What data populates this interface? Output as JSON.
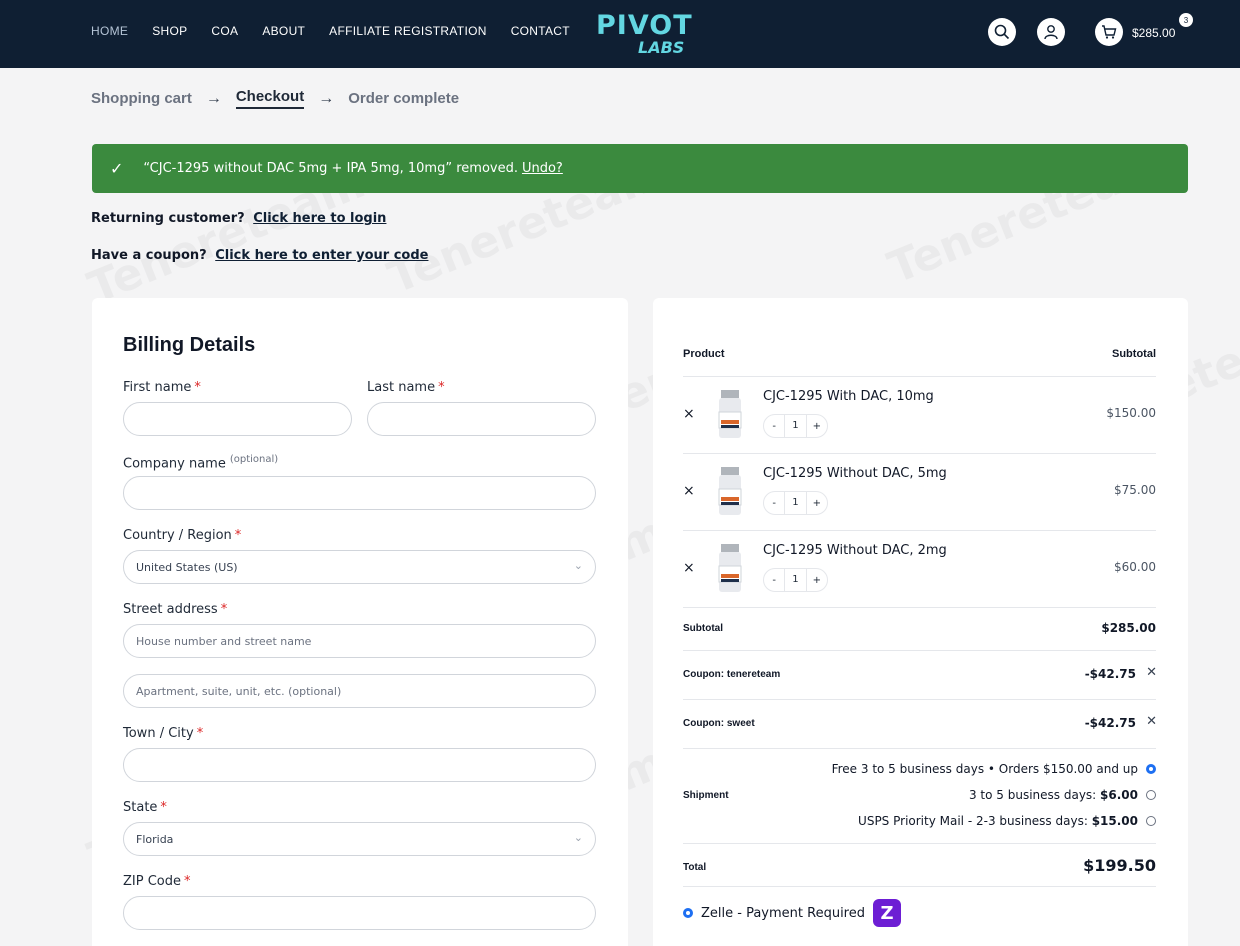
{
  "header": {
    "nav": [
      "HOME",
      "SHOP",
      "COA",
      "ABOUT",
      "AFFILIATE REGISTRATION",
      "CONTACT"
    ],
    "logo_text": "PIVOT",
    "logo_sub": "LABS",
    "cart_total": "$285.00",
    "cart_count": "3",
    "icons": [
      "search-icon",
      "user-icon",
      "cart-icon"
    ]
  },
  "steps": {
    "items": [
      "Shopping cart",
      "Checkout",
      "Order complete"
    ],
    "current": "Checkout"
  },
  "notice": {
    "text": "“CJC-1295 without DAC 5mg + IPA 5mg, 10mg” removed.",
    "undo": "Undo?"
  },
  "returning": {
    "text": "Returning customer?",
    "link": "Click here to login"
  },
  "coupon_prompt": {
    "text": "Have a coupon?",
    "link": "Click here to enter your code"
  },
  "billing": {
    "title": "Billing Details",
    "first_name": "First name",
    "last_name": "Last name",
    "company": "Company name",
    "optional": "(optional)",
    "country_label": "Country / Region",
    "country_value": "United States (US)",
    "street_label": "Street address",
    "street_placeholder": "House number and street name",
    "street2_placeholder": "Apartment, suite, unit, etc. (optional)",
    "city_label": "Town / City",
    "state_label": "State",
    "state_value": "Florida",
    "zip_label": "ZIP Code",
    "req": "*"
  },
  "order": {
    "col_product": "Product",
    "col_subtotal": "Subtotal",
    "items": [
      {
        "name": "CJC-1295 With DAC, 10mg",
        "qty": "1",
        "price": "$150.00"
      },
      {
        "name": "CJC-1295 Without DAC, 5mg",
        "qty": "1",
        "price": "$75.00"
      },
      {
        "name": "CJC-1295 Without DAC, 2mg",
        "qty": "1",
        "price": "$60.00"
      }
    ],
    "subtotal_label": "Subtotal",
    "subtotal": "$285.00",
    "coupons": [
      {
        "label": "Coupon: tenereteam",
        "value": "-$42.75"
      },
      {
        "label": "Coupon: sweet",
        "value": "-$42.75"
      }
    ],
    "shipment_label": "Shipment",
    "shipping": [
      {
        "text": "Free 3 to 5 business days • Orders $150.00 and up",
        "price": "",
        "selected": true
      },
      {
        "text": "3 to 5 business days: ",
        "price": "$6.00",
        "selected": false
      },
      {
        "text": "USPS Priority Mail - 2-3 business days: ",
        "price": "$15.00",
        "selected": false
      }
    ],
    "total_label": "Total",
    "total": "$199.50",
    "payment": "Zelle - Payment Required",
    "zelle_letter": "Z"
  },
  "watermark": "Tenereteam"
}
